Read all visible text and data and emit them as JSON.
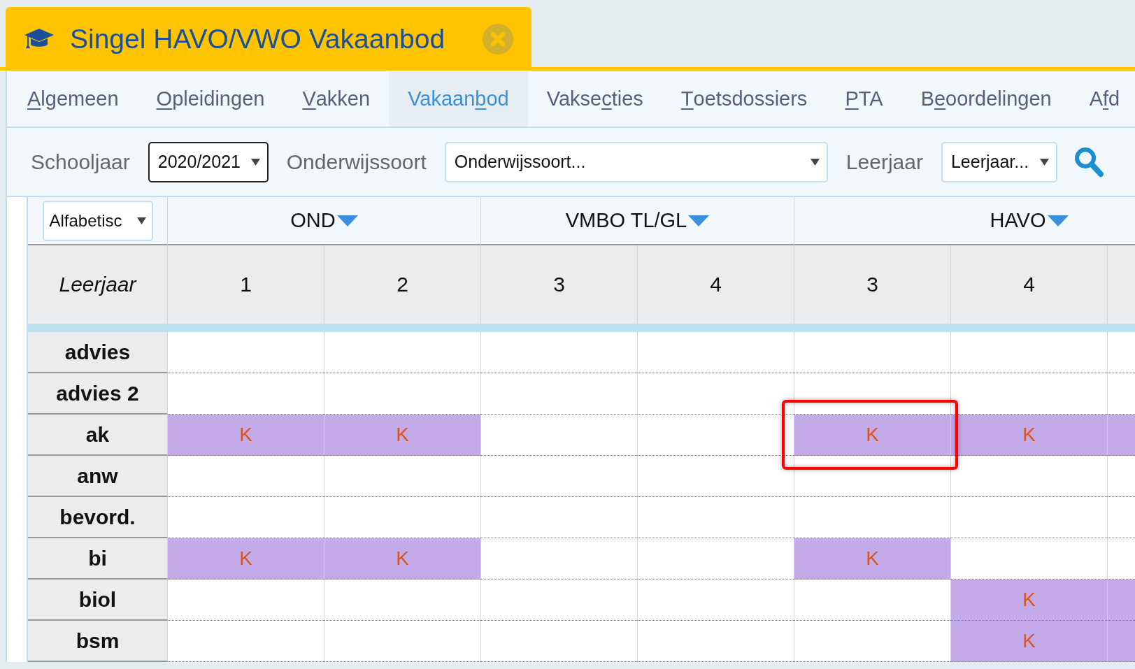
{
  "window": {
    "title": "Singel HAVO/VWO Vakaanbod"
  },
  "tabs": [
    {
      "label": {
        "key": "A",
        "after": "lgemeen"
      },
      "selected": false
    },
    {
      "label": {
        "key": "O",
        "after": "pleidingen"
      },
      "selected": false
    },
    {
      "label": {
        "key": "V",
        "after": "akken"
      },
      "selected": false
    },
    {
      "label": {
        "before": "Vakaan",
        "key": "b",
        "after": "od"
      },
      "selected": true
    },
    {
      "label": {
        "before": "Vakse",
        "key": "c",
        "after": "ties"
      },
      "selected": false
    },
    {
      "label": {
        "key": "T",
        "after": "oetsdossiers"
      },
      "selected": false
    },
    {
      "label": {
        "key": "P",
        "after": "TA"
      },
      "selected": false
    },
    {
      "label": {
        "before": "B",
        "key": "e",
        "after": "oordelingen"
      },
      "selected": false
    },
    {
      "label": {
        "before": "A",
        "key": "f",
        "after": "d"
      },
      "selected": false
    }
  ],
  "filters": [
    {
      "label": "Schooljaar",
      "value": "2020/2021",
      "focused": true
    },
    {
      "label": "Onderwijssoort",
      "value": "Onderwijssoort...",
      "focused": false
    },
    {
      "label": "Leerjaar",
      "value": "Leerjaar...",
      "focused": false
    }
  ],
  "grid": {
    "sort_select": "Alfabetisc",
    "row_header": "Leerjaar",
    "groups": [
      {
        "name": "OND",
        "years": [
          {
            "label": "1"
          },
          {
            "label": "2"
          }
        ]
      },
      {
        "name": "VMBO TL/GL",
        "years": [
          {
            "label": "3"
          },
          {
            "label": "4"
          }
        ]
      },
      {
        "name": "HAVO",
        "years": [
          {
            "label": "3"
          },
          {
            "label": "4"
          }
        ]
      }
    ],
    "rows": [
      {
        "subject": "advies",
        "cells": [
          {
            "filled": false,
            "highlighted": false
          },
          {
            "filled": false,
            "highlighted": false
          },
          {
            "filled": false,
            "highlighted": false
          },
          {
            "filled": false,
            "highlighted": false
          },
          {
            "filled": false,
            "highlighted": false
          },
          {
            "filled": false,
            "highlighted": false
          },
          {
            "filled": false,
            "highlighted": false
          }
        ]
      },
      {
        "subject": "advies 2",
        "cells": [
          {
            "filled": false,
            "highlighted": false
          },
          {
            "filled": false,
            "highlighted": false
          },
          {
            "filled": false,
            "highlighted": false
          },
          {
            "filled": false,
            "highlighted": false
          },
          {
            "filled": false,
            "highlighted": false
          },
          {
            "filled": false,
            "highlighted": false
          },
          {
            "filled": false,
            "highlighted": false
          }
        ]
      },
      {
        "subject": "ak",
        "cells": [
          {
            "filled": true,
            "text": "K",
            "highlighted": false
          },
          {
            "filled": true,
            "text": "K",
            "highlighted": false
          },
          {
            "filled": false,
            "highlighted": false
          },
          {
            "filled": false,
            "highlighted": false
          },
          {
            "filled": true,
            "text": "K",
            "highlighted": true
          },
          {
            "filled": true,
            "text": "K",
            "highlighted": false
          },
          {
            "filled": true,
            "highlighted": false
          }
        ]
      },
      {
        "subject": "anw",
        "cells": [
          {
            "filled": false,
            "highlighted": false
          },
          {
            "filled": false,
            "highlighted": false
          },
          {
            "filled": false,
            "highlighted": false
          },
          {
            "filled": false,
            "highlighted": false
          },
          {
            "filled": false,
            "highlighted": false
          },
          {
            "filled": false,
            "highlighted": false
          },
          {
            "filled": false,
            "highlighted": false
          }
        ]
      },
      {
        "subject": "bevord.",
        "cells": [
          {
            "filled": false,
            "highlighted": false
          },
          {
            "filled": false,
            "highlighted": false
          },
          {
            "filled": false,
            "highlighted": false
          },
          {
            "filled": false,
            "highlighted": false
          },
          {
            "filled": false,
            "highlighted": false
          },
          {
            "filled": false,
            "highlighted": false
          },
          {
            "filled": false,
            "highlighted": false
          }
        ]
      },
      {
        "subject": "bi",
        "cells": [
          {
            "filled": true,
            "text": "K",
            "highlighted": false
          },
          {
            "filled": true,
            "text": "K",
            "highlighted": false
          },
          {
            "filled": false,
            "highlighted": false
          },
          {
            "filled": false,
            "highlighted": false
          },
          {
            "filled": true,
            "text": "K",
            "highlighted": false
          },
          {
            "filled": false,
            "highlighted": false
          },
          {
            "filled": false,
            "highlighted": false
          }
        ]
      },
      {
        "subject": "biol",
        "cells": [
          {
            "filled": false,
            "highlighted": false
          },
          {
            "filled": false,
            "highlighted": false
          },
          {
            "filled": false,
            "highlighted": false
          },
          {
            "filled": false,
            "highlighted": false
          },
          {
            "filled": false,
            "highlighted": false
          },
          {
            "filled": true,
            "text": "K",
            "highlighted": false
          },
          {
            "filled": true,
            "highlighted": false
          }
        ]
      },
      {
        "subject": "bsm",
        "cells": [
          {
            "filled": false,
            "highlighted": false
          },
          {
            "filled": false,
            "highlighted": false
          },
          {
            "filled": false,
            "highlighted": false
          },
          {
            "filled": false,
            "highlighted": false
          },
          {
            "filled": false,
            "highlighted": false
          },
          {
            "filled": true,
            "text": "K",
            "highlighted": false
          },
          {
            "filled": true,
            "highlighted": false
          }
        ]
      }
    ]
  }
}
